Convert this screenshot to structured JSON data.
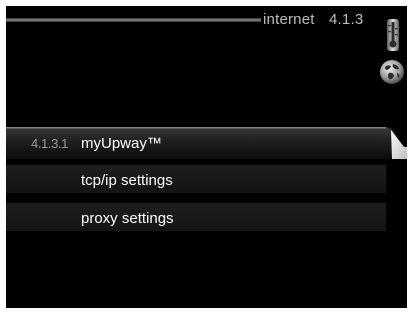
{
  "header": {
    "title": "internet",
    "menu_number": "4.1.3",
    "status_icons": [
      "thermometer-icon",
      "globe-icon"
    ]
  },
  "menu": {
    "items": [
      {
        "code": "4.1.3.1",
        "label": "myUpway™",
        "selected": true
      },
      {
        "code": "",
        "label": "tcp/ip settings",
        "selected": false
      },
      {
        "code": "",
        "label": "proxy settings",
        "selected": false
      }
    ]
  },
  "colors": {
    "background": "#000000",
    "text": "#ffffff",
    "header_text": "#bdbdbd",
    "code_text": "#9a9a9a"
  }
}
